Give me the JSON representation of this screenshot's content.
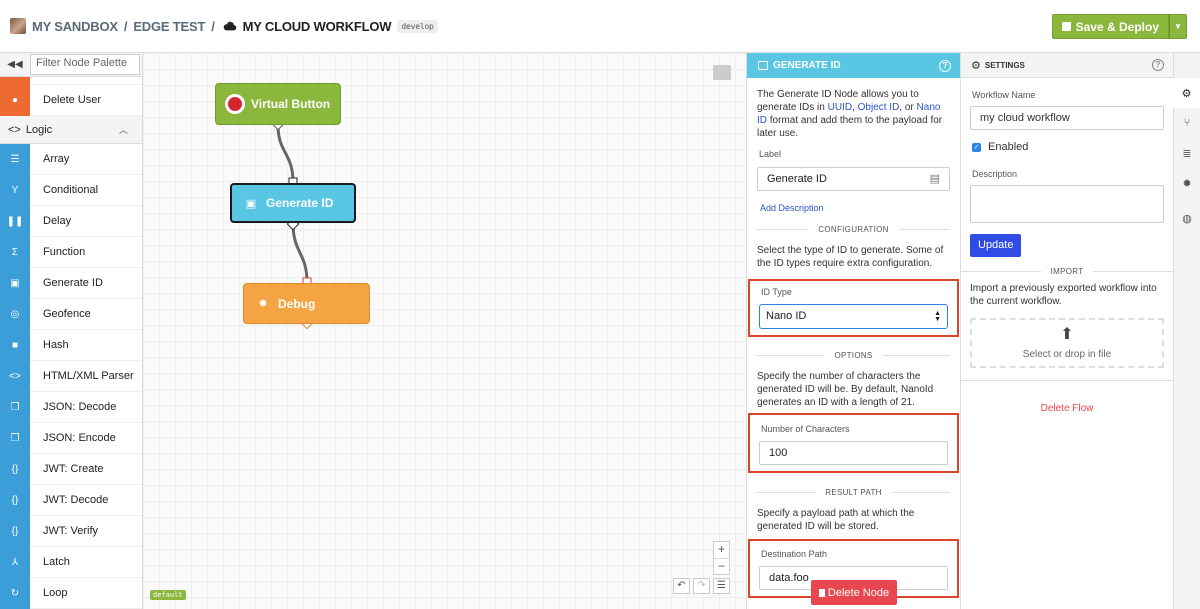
{
  "header": {
    "crumbs": [
      "MY SANDBOX",
      "EDGE TEST"
    ],
    "separator": "/",
    "workflow_name": "MY CLOUD WORKFLOW",
    "branch": "develop",
    "save_label": "Save & Deploy",
    "colors": {
      "save": "#8cb73d"
    }
  },
  "palette": {
    "filter_placeholder": "Filter Node Palette",
    "top_items": [
      {
        "label": "Delete User",
        "icon": "user-minus-icon",
        "color": "#ee6a33"
      }
    ],
    "category": "Logic",
    "items": [
      {
        "label": "Array",
        "icon": "list-icon"
      },
      {
        "label": "Conditional",
        "icon": "branch-icon"
      },
      {
        "label": "Delay",
        "icon": "pause-icon"
      },
      {
        "label": "Function",
        "icon": "sigma-icon"
      },
      {
        "label": "Generate ID",
        "icon": "id-card-icon"
      },
      {
        "label": "Geofence",
        "icon": "target-icon"
      },
      {
        "label": "Hash",
        "icon": "lock-icon"
      },
      {
        "label": "HTML/XML Parser",
        "icon": "code-icon"
      },
      {
        "label": "JSON: Decode",
        "icon": "copy-icon"
      },
      {
        "label": "JSON: Encode",
        "icon": "copy-icon"
      },
      {
        "label": "JWT: Create",
        "icon": "braces-icon"
      },
      {
        "label": "JWT: Decode",
        "icon": "braces-icon"
      },
      {
        "label": "JWT: Verify",
        "icon": "braces-icon"
      },
      {
        "label": "Latch",
        "icon": "fork-icon"
      },
      {
        "label": "Loop",
        "icon": "loop-icon"
      }
    ],
    "colors": {
      "node_icon": "#3b9ed8"
    }
  },
  "canvas": {
    "nodes": [
      {
        "label": "Virtual Button",
        "color": "#8cb73d"
      },
      {
        "label": "Generate ID",
        "color": "#59c6e3"
      },
      {
        "label": "Debug",
        "color": "#f4a442"
      }
    ],
    "zoom_in": "+",
    "zoom_out": "−",
    "default_tag": "default"
  },
  "node_panel": {
    "title": "GENERATE ID",
    "description_parts": [
      "The Generate ID Node allows you to generate IDs in ",
      "UUID",
      ", ",
      "Object ID",
      ", or ",
      "Nano ID",
      " format and add them to the payload for later use."
    ],
    "label_label": "Label",
    "label_value": "Generate ID",
    "add_description": "Add Description",
    "configuration_title": "CONFIGURATION",
    "configuration_text": "Select the type of ID to generate. Some of the ID types require extra configuration.",
    "id_type_label": "ID Type",
    "id_type_value": "Nano ID",
    "options_title": "OPTIONS",
    "options_text": "Specify the number of characters the generated ID will be. By default, NanoId generates an ID with a length of 21.",
    "num_chars_label": "Number of Characters",
    "num_chars_value": "100",
    "result_title": "RESULT PATH",
    "result_text": "Specify a payload path at which the generated ID will be stored.",
    "dest_label": "Destination Path",
    "dest_value": "data.foo",
    "delete_label": "Delete Node",
    "colors": {
      "header": "#59c6e3",
      "highlight": "#d9452b",
      "delete": "#e8474f"
    }
  },
  "settings": {
    "title": "SETTINGS",
    "workflow_name_label": "Workflow Name",
    "workflow_name_value": "my cloud workflow",
    "enabled_label": "Enabled",
    "enabled": true,
    "description_label": "Description",
    "update_label": "Update",
    "import_title": "IMPORT",
    "import_text": "Import a previously exported workflow into the current workflow.",
    "drop_text": "Select or drop in file",
    "delete_flow": "Delete Flow",
    "colors": {
      "update": "#2f4de6"
    }
  }
}
